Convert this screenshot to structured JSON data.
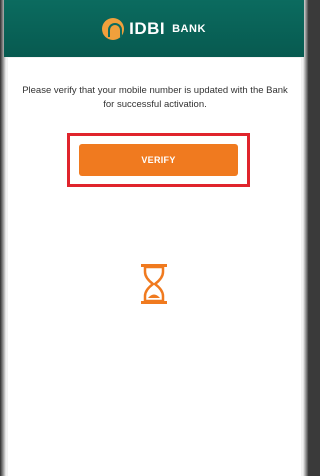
{
  "header": {
    "logo_main": "IDBI",
    "logo_sub": "BANK"
  },
  "main": {
    "message": "Please verify that your mobile number is updated with the Bank for successful activation.",
    "verify_label": "VERIFY",
    "loading_icon": "hourglass-icon"
  },
  "colors": {
    "header_bg": "#0b6b5f",
    "accent": "#f07a1f",
    "highlight": "#e0242c"
  }
}
